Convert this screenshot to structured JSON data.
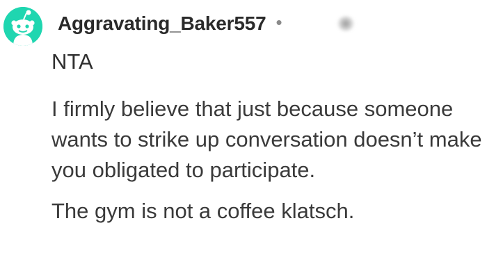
{
  "comment": {
    "username": "Aggravating_Baker557",
    "separator": "•",
    "flair": "NTA",
    "paragraphs": [
      "I firmly believe that just because someone wants to strike up conversation doesn’t make you obligated to participate.",
      "The gym is not a coffee klatsch."
    ]
  },
  "colors": {
    "avatar_background": "#1fd6b0",
    "text": "#3a3a3a",
    "username": "#2a2a2a"
  },
  "icons": {
    "avatar": "snoo-avatar-icon"
  }
}
